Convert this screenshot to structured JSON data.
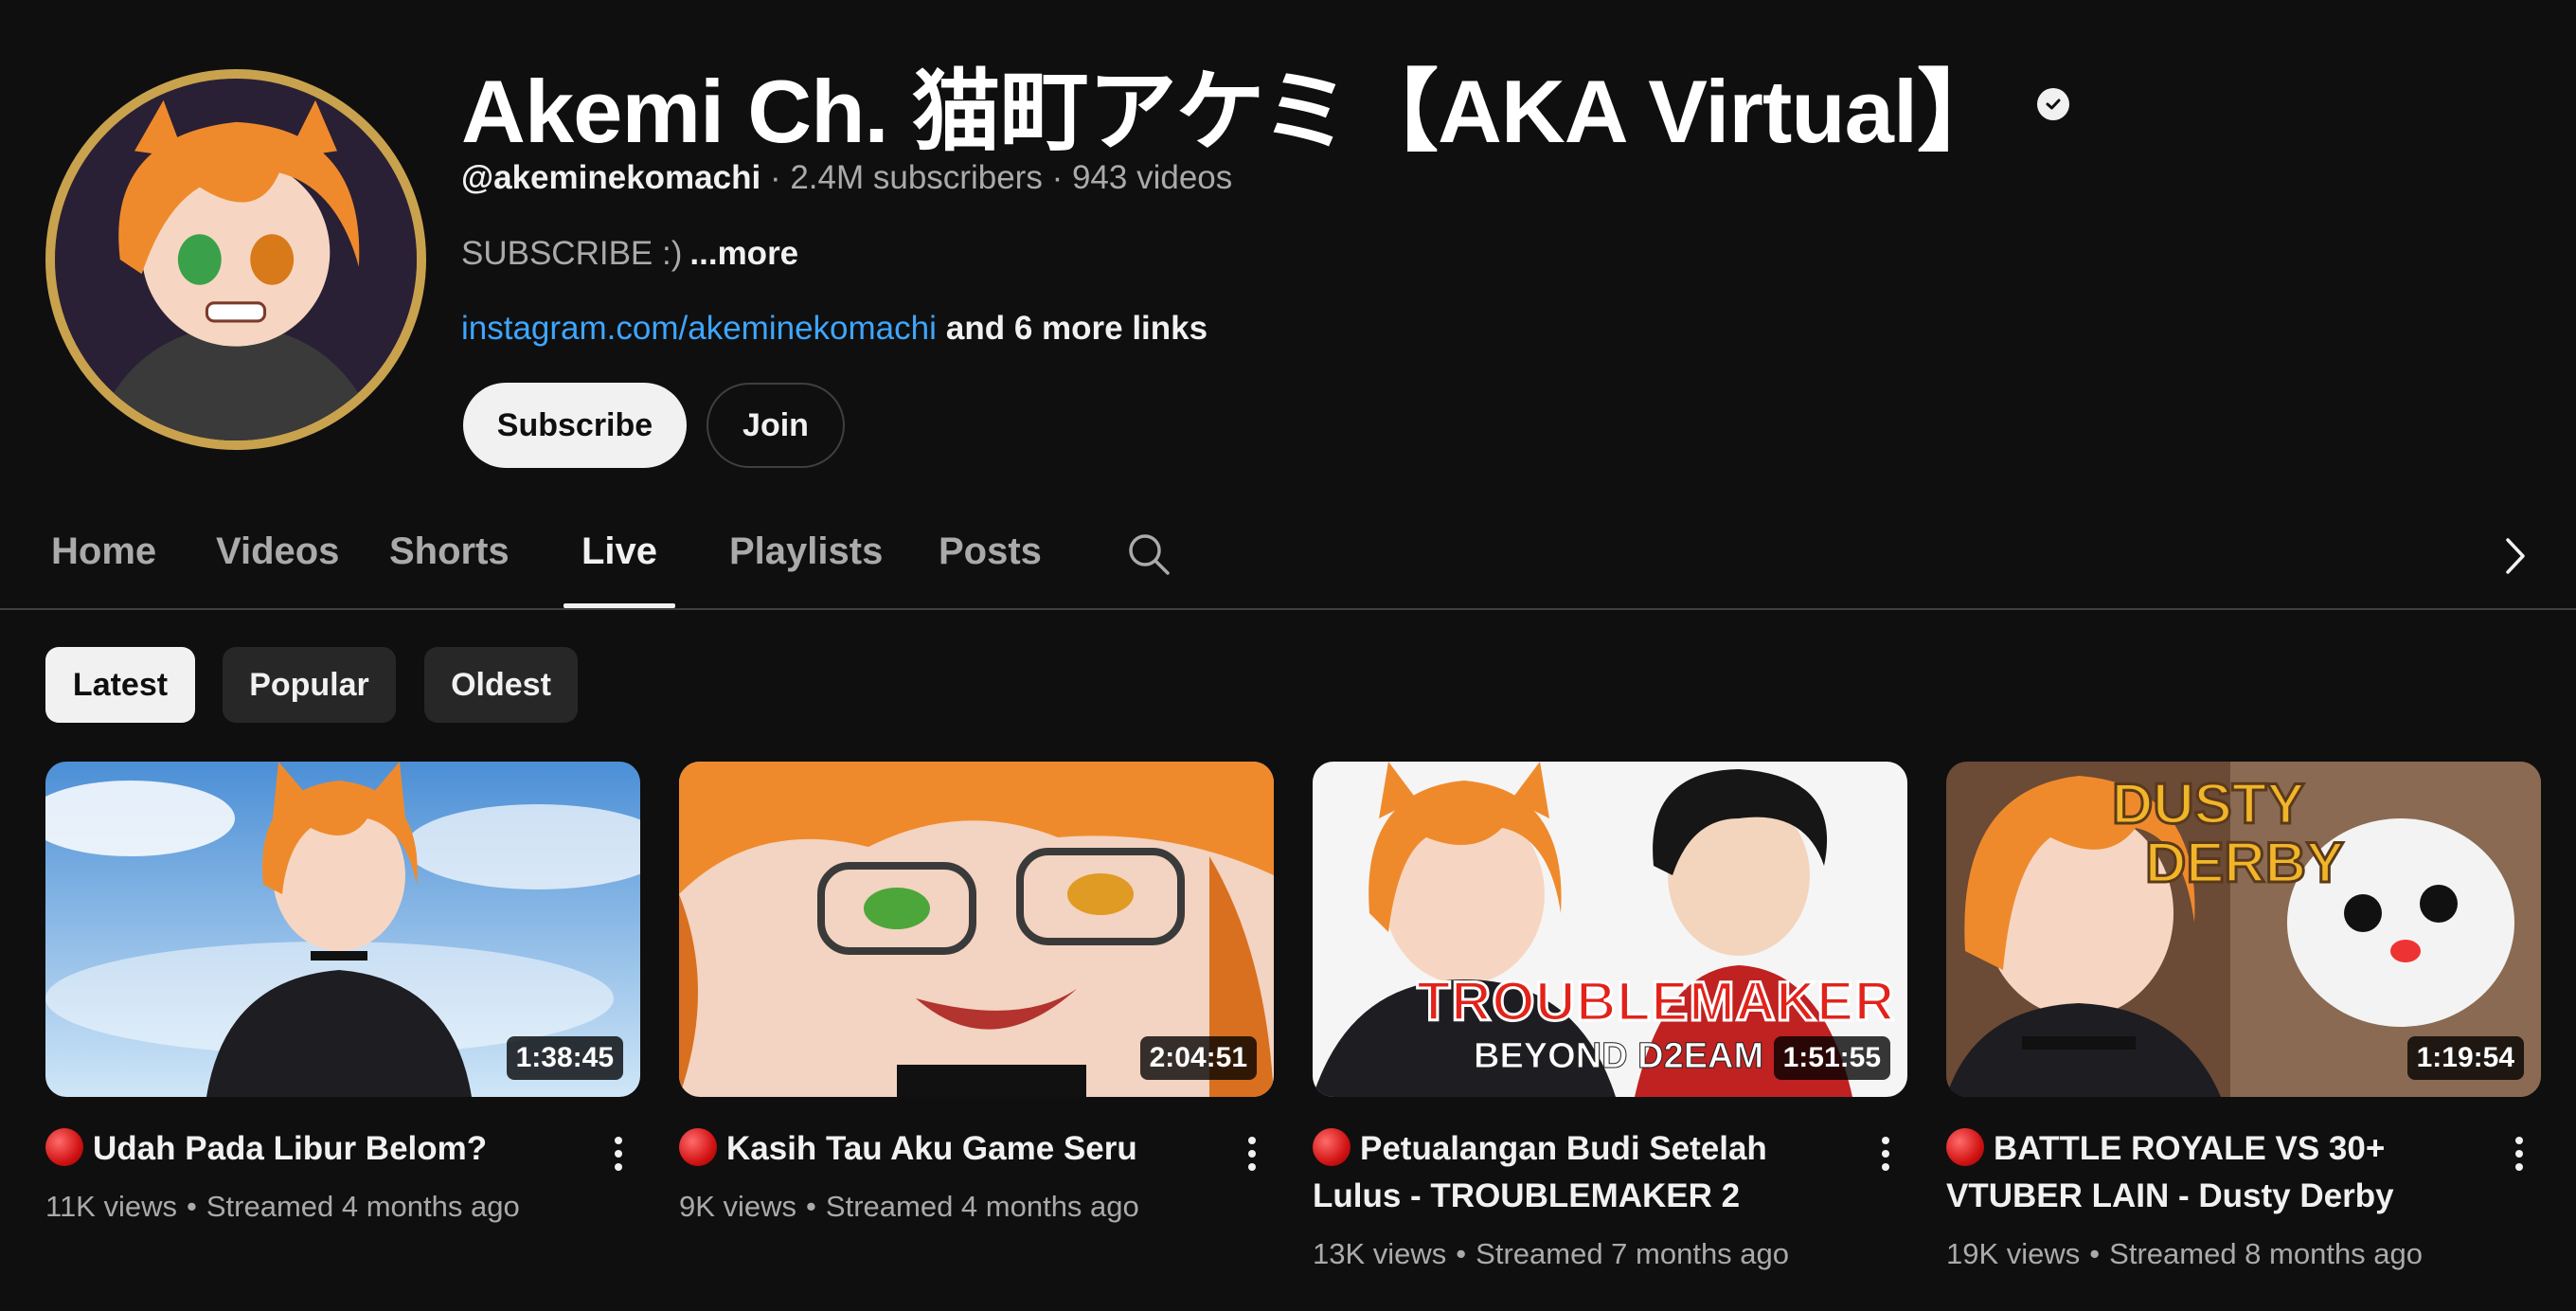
{
  "channel": {
    "name": "Akemi Ch. 猫町アケミ【AKA Virtual】",
    "handle": "@akeminekomachi",
    "subscribers": "2.4M subscribers",
    "videos": "943 videos",
    "separator": "·",
    "description": "SUBSCRIBE :)",
    "more_label": "...more",
    "link_text": "instagram.com/akeminekomachi",
    "more_links": "and 6 more links",
    "subscribe_label": "Subscribe",
    "join_label": "Join"
  },
  "tabs": [
    {
      "label": "Home"
    },
    {
      "label": "Videos"
    },
    {
      "label": "Shorts"
    },
    {
      "label": "Live",
      "active": true
    },
    {
      "label": "Playlists"
    },
    {
      "label": "Posts"
    }
  ],
  "chips": [
    {
      "label": "Latest",
      "active": true
    },
    {
      "label": "Popular"
    },
    {
      "label": "Oldest"
    }
  ],
  "videos": [
    {
      "title": "Udah Pada Libur Belom?",
      "duration": "1:38:45",
      "views": "11K views",
      "streamed": "Streamed 4 months ago"
    },
    {
      "title": "Kasih Tau Aku Game Seru",
      "duration": "2:04:51",
      "views": "9K views",
      "streamed": "Streamed 4 months ago"
    },
    {
      "title": "Petualangan Budi Setelah Lulus - TROUBLEMAKER 2",
      "duration": "1:51:55",
      "views": "13K views",
      "streamed": "Streamed 7 months ago",
      "thumb_text_1": "TROUBLEMAKER",
      "thumb_text_2": "BEYOND D2EAM"
    },
    {
      "title": "BATTLE ROYALE VS 30+ VTUBER LAIN - Dusty Derby",
      "duration": "1:19:54",
      "views": "19K views",
      "streamed": "Streamed 8 months ago",
      "thumb_text_1": "DUSTY",
      "thumb_text_2": "DERBY"
    }
  ],
  "meta_dot": "•",
  "colors": {
    "background": "#0f0f0f",
    "link": "#3ea6ff",
    "live_red": "#d21414",
    "avatar_ring": "#c9a24e"
  }
}
